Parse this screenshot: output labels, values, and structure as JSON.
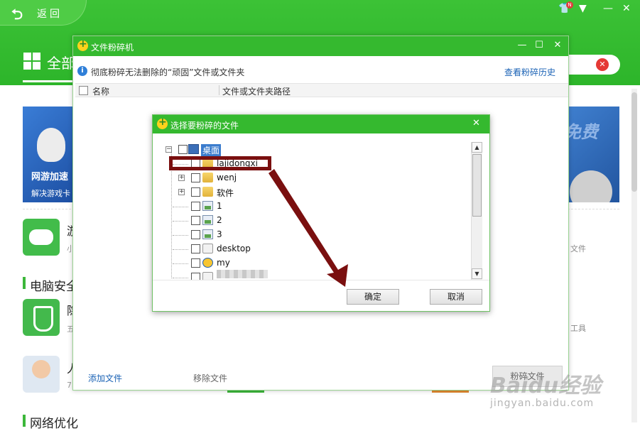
{
  "app": {
    "back_label": "返回",
    "notification_badge": "N",
    "tab_label": "全部",
    "banner_left_title": "网游加速",
    "banner_left_subtitle": "解决游戏卡",
    "banner_right_text": "免费",
    "rows": [
      {
        "title": "游",
        "subtitle": "小"
      },
      {
        "title": "隐",
        "subtitle": "五"
      },
      {
        "title": "人",
        "subtitle": "7"
      }
    ],
    "section_security": "电脑安全",
    "section_network": "网络优化",
    "right_files_text": "文件",
    "right_tools_text": "工具"
  },
  "shredder": {
    "title": "文件粉碎机",
    "info_text": "彻底粉碎无法删除的“顽固”文件或文件夹",
    "history_link": "查看粉碎历史",
    "col_name": "名称",
    "col_path": "文件或文件夹路径",
    "add_file": "添加文件",
    "remove_file": "移除文件",
    "shred_button": "粉碎文件"
  },
  "chooser": {
    "title": "选择要粉碎的文件",
    "tree": {
      "root": "桌面",
      "items": [
        "lajidongxi",
        "wenj",
        "软件",
        "1",
        "2",
        "3",
        "desktop",
        "my"
      ]
    },
    "ok_label": "确定",
    "cancel_label": "取消"
  },
  "watermark": {
    "text": "Baidu经验",
    "sub": "jingyan.baidu.com"
  },
  "colors": {
    "brand_green": "#35b92f",
    "annotation_red": "#7a0f0f",
    "link_blue": "#1a62b5"
  }
}
